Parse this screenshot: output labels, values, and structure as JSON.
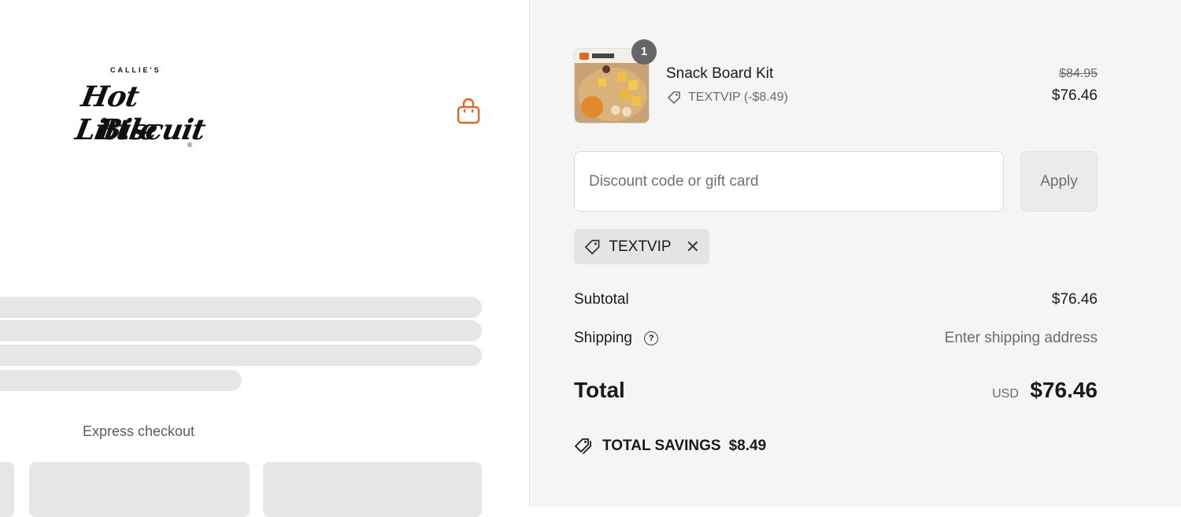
{
  "brand": {
    "top_text": "CALLIE'S",
    "line1": "Hot Little",
    "line2": "Biscuit",
    "registered": "®"
  },
  "left": {
    "express_checkout_label": "Express checkout"
  },
  "cart": {
    "item": {
      "name": "Snack Board Kit",
      "quantity": "1",
      "discount_line": "TEXTVIP (-$8.49)",
      "original_price": "$84.95",
      "price": "$76.46"
    }
  },
  "discount": {
    "placeholder": "Discount code or gift card",
    "value": "",
    "apply_label": "Apply",
    "applied_code": "TEXTVIP"
  },
  "summary": {
    "subtotal_label": "Subtotal",
    "subtotal_value": "$76.46",
    "shipping_label": "Shipping",
    "shipping_value": "Enter shipping address",
    "total_label": "Total",
    "currency": "USD",
    "total_value": "$76.46",
    "savings_label": "TOTAL SAVINGS",
    "savings_value": "$8.49"
  },
  "colors": {
    "accent": "#e0662a",
    "sidebar_bg": "#f5f5f5"
  }
}
